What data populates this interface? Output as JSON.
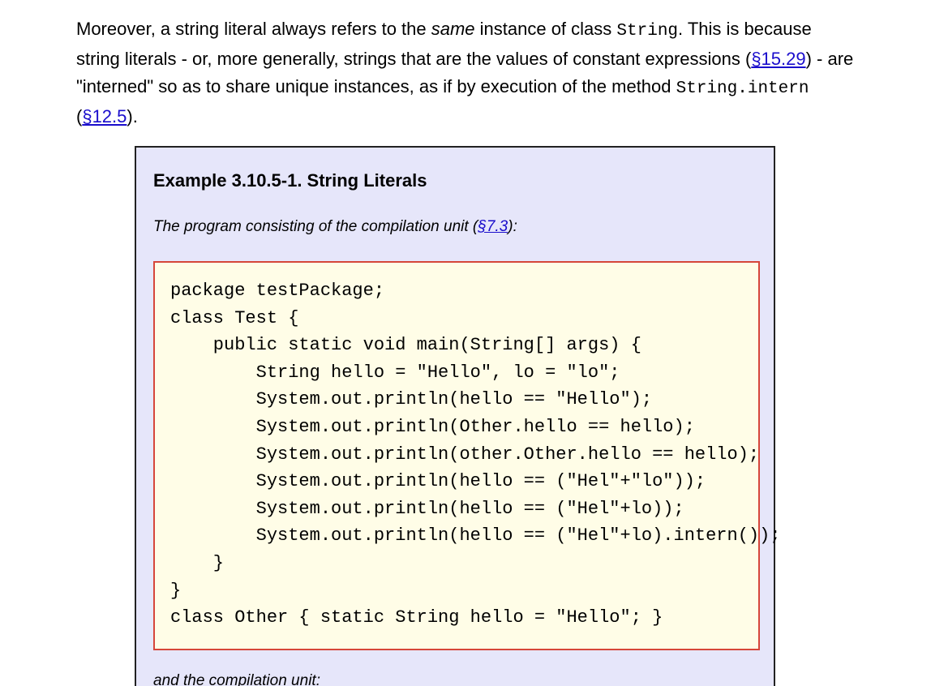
{
  "intro": {
    "t1": "Moreover, a string literal always refers to the ",
    "t1_em": "same",
    "t2": " instance of class ",
    "code1": "String",
    "t3": ". This is because string literals - or, more generally, strings that are the values of constant expressions (",
    "link1": "§15.29",
    "t4": ") - are \"interned\" so as to share unique instances, as if by execution of the method ",
    "code2": "String.intern",
    "t5": " (",
    "link2": "§12.5",
    "t6": ")."
  },
  "example": {
    "title": "Example 3.10.5-1. String Literals",
    "intro_text": "The program consisting of the compilation unit (",
    "intro_link": "§7.3",
    "intro_end": "):",
    "code_lines": [
      "package testPackage;",
      "class Test {",
      "    public static void main(String[] args) {",
      "        String hello = \"Hello\", lo = \"lo\";",
      "        System.out.println(hello == \"Hello\");",
      "        System.out.println(Other.hello == hello);",
      "        System.out.println(other.Other.hello == hello);",
      "        System.out.println(hello == (\"Hel\"+\"lo\"));",
      "        System.out.println(hello == (\"Hel\"+lo));",
      "        System.out.println(hello == (\"Hel\"+lo).intern());",
      "    }",
      "}",
      "class Other { static String hello = \"Hello\"; }"
    ],
    "outro_text": "and the compilation unit:"
  },
  "colors": {
    "link": "#1a0dcc",
    "example_background": "#e6e6fa",
    "program_background": "#fffde7",
    "program_border": "#d6463a"
  }
}
